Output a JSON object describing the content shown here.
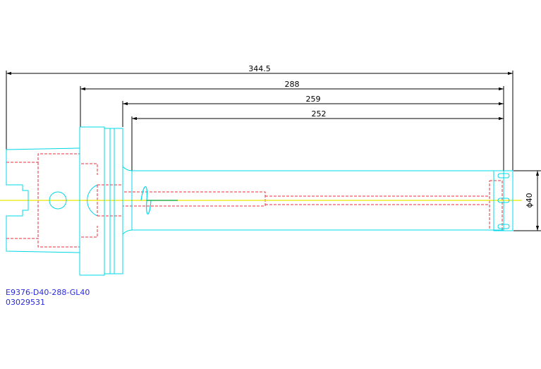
{
  "drawing": {
    "part_number": "E9376-D40-288-GL40",
    "article_number": "03029531",
    "dimensions": {
      "overall_length": "344.5",
      "flange_to_tip": "288",
      "shoulder_to_tip": "259",
      "body_length": "252",
      "diameter": "ϕ40"
    },
    "colors": {
      "outline": "#00d8e8",
      "hidden_line": "#e8323c",
      "centerline": "#e8e800",
      "dimension": "#000000",
      "text": "#2a2ae0",
      "coolant_symbol": "#00a651"
    }
  }
}
